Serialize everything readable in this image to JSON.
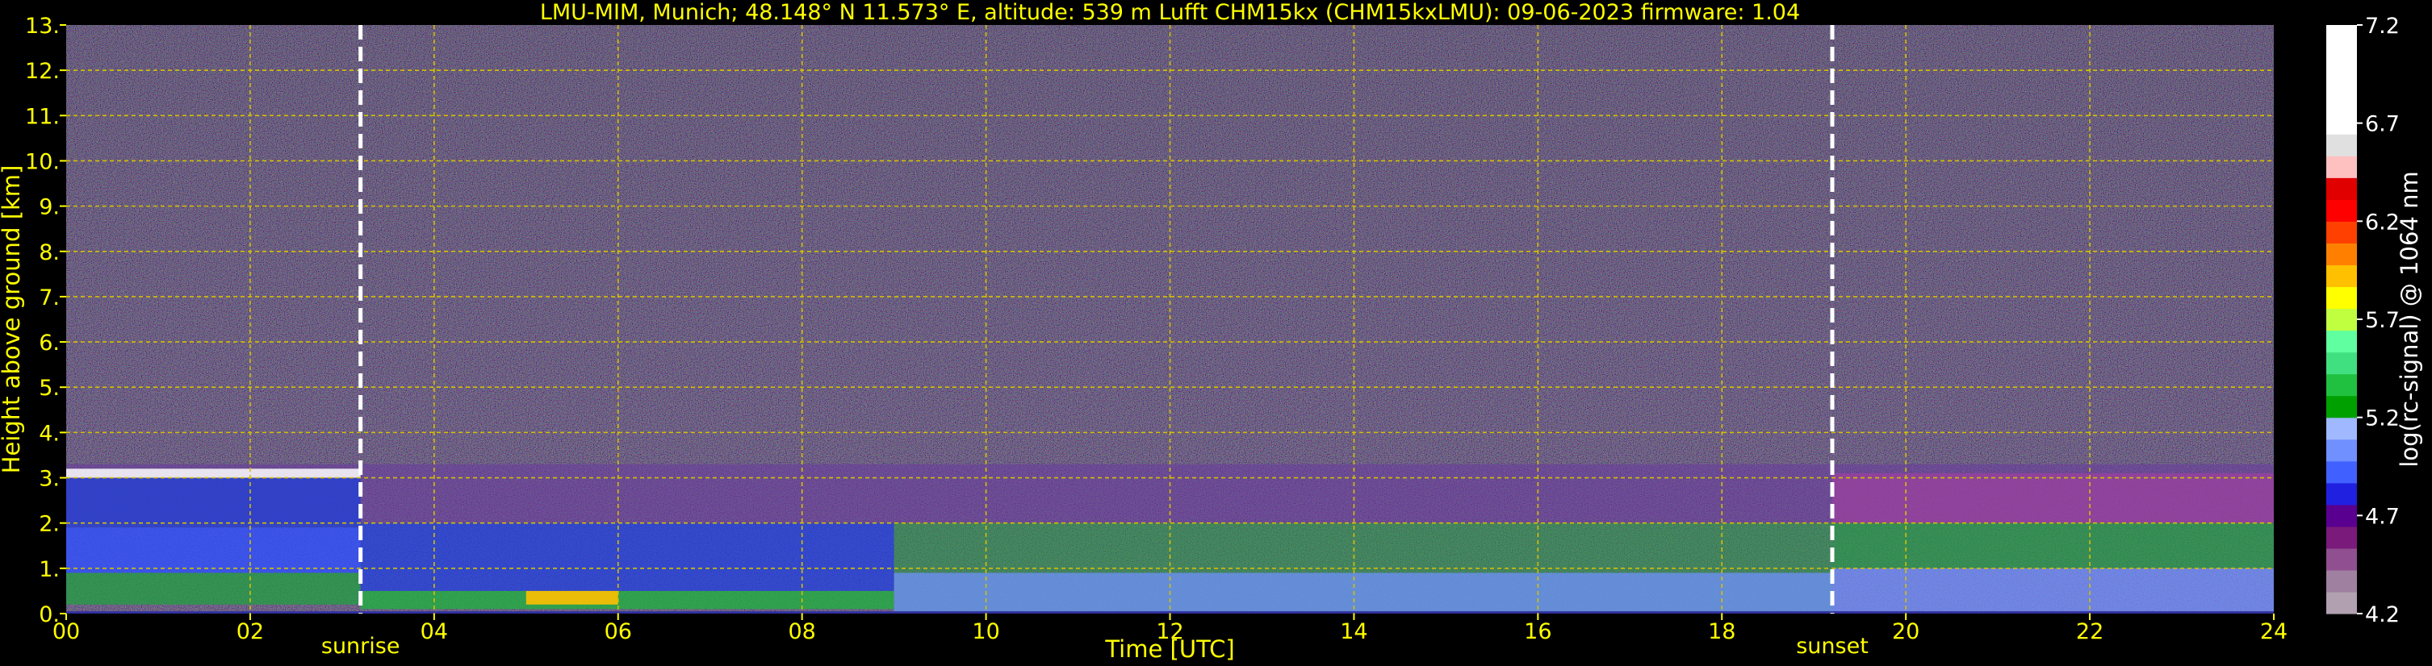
{
  "chart_data": {
    "type": "heatmap",
    "title": "LMU-MIM, Munich; 48.148° N 11.573° E, altitude: 539 m    Lufft CHM15kx (CHM15kxLMU): 09-06-2023    firmware: 1.04",
    "xlabel": "Time [UTC]",
    "ylabel": "Height above ground [km]",
    "xlim": [
      0,
      24
    ],
    "ylim": [
      0,
      13
    ],
    "x_ticks": [
      "00",
      "02",
      "04",
      "06",
      "08",
      "10",
      "12",
      "14",
      "16",
      "18",
      "20",
      "22",
      "24"
    ],
    "x_tick_values": [
      0,
      2,
      4,
      6,
      8,
      10,
      12,
      14,
      16,
      18,
      20,
      22,
      24
    ],
    "y_ticks": [
      "0.",
      "1.",
      "2.",
      "3.",
      "4.",
      "5.",
      "6.",
      "7.",
      "8.",
      "9.",
      "10.",
      "11.",
      "12.",
      "13."
    ],
    "y_tick_values": [
      0,
      1,
      2,
      3,
      4,
      5,
      6,
      7,
      8,
      9,
      10,
      11,
      12,
      13
    ],
    "grid": true,
    "events": [
      {
        "label": "sunrise",
        "x": 3.2
      },
      {
        "label": "sunset",
        "x": 19.2
      }
    ],
    "colorbar": {
      "label": "log(rc-signal) @ 1064 nm",
      "range": [
        4.2,
        7.2
      ],
      "ticks": [
        "4.2",
        "4.7",
        "5.2",
        "5.7",
        "6.2",
        "6.7",
        "7.2"
      ],
      "tick_values": [
        4.2,
        4.7,
        5.2,
        5.7,
        6.2,
        6.7,
        7.2
      ],
      "colors": [
        "#b0a0b0",
        "#a080a0",
        "#904f90",
        "#7a1a7a",
        "#5a0090",
        "#2020e0",
        "#4060ff",
        "#7090ff",
        "#a0b8ff",
        "#00a000",
        "#20c040",
        "#40e080",
        "#60ffa0",
        "#c0ff40",
        "#ffff00",
        "#ffc000",
        "#ff8000",
        "#ff4000",
        "#ff0000",
        "#e00000",
        "#ffc0c0",
        "#e0e0e0",
        "#ffffff",
        "#ffffff",
        "#ffffff",
        "#ffffff",
        "#ffffff"
      ]
    }
  }
}
